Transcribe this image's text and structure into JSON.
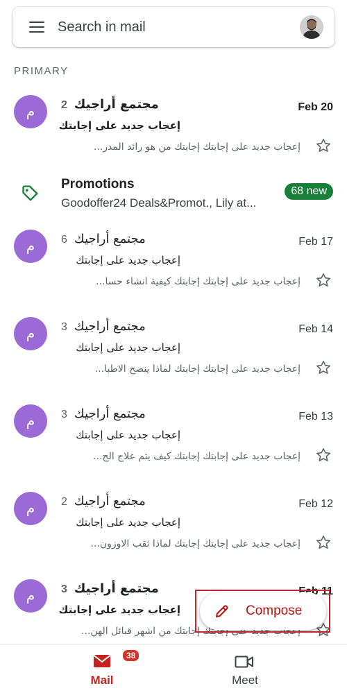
{
  "search": {
    "placeholder": "Search in mail"
  },
  "section": {
    "label": "PRIMARY"
  },
  "emails": [
    {
      "sender": "مجتمع أراجيك",
      "count": "2",
      "date": "Feb 20",
      "subject": "إعجاب جديد على إجابتك",
      "snippet": "إعجاب جديد على إجابتك إجابتك من هو رائد المدر...",
      "avatar_letter": "م",
      "unread": true
    },
    {
      "sender": "مجتمع أراجيك",
      "count": "6",
      "date": "Feb 17",
      "subject": "إعجاب جديد على إجابتك",
      "snippet": "إعجاب جديد على إجابتك إجابتك كيفية انشاء حسا...",
      "avatar_letter": "م",
      "unread": false
    },
    {
      "sender": "مجتمع أراجيك",
      "count": "3",
      "date": "Feb 14",
      "subject": "إعجاب جديد على إجابتك",
      "snippet": "إعجاب جديد على إجابتك إجابتك لماذا ينصح الاطبا...",
      "avatar_letter": "م",
      "unread": false
    },
    {
      "sender": "مجتمع أراجيك",
      "count": "3",
      "date": "Feb 13",
      "subject": "إعجاب جديد على إجابتك",
      "snippet": "إعجاب جديد على إجابتك إجابتك كيف يتم علاج الح...",
      "avatar_letter": "م",
      "unread": false
    },
    {
      "sender": "مجتمع أراجيك",
      "count": "2",
      "date": "Feb 12",
      "subject": "إعجاب جديد على إجابتك",
      "snippet": "إعجاب جديد على إجابتك إجابتك لماذا ثقب الاوزون...",
      "avatar_letter": "م",
      "unread": false
    },
    {
      "sender": "مجتمع أراجيك",
      "count": "3",
      "date": "Feb 11",
      "subject": "إعجاب جديد على إجابتك",
      "snippet": "إعجاب جديد على إجابتك إجابتك من اشهر قبائل الهن...",
      "avatar_letter": "م",
      "unread": true
    }
  ],
  "promotions": {
    "title": "Promotions",
    "senders": "Goodoffer24 Deals&Promot., Lily at...",
    "badge": "68 new"
  },
  "compose": {
    "label": "Compose"
  },
  "nav": {
    "mail_label": "Mail",
    "mail_badge": "38",
    "meet_label": "Meet"
  },
  "colors": {
    "accent": "#b31412",
    "avatar": "#9c6ad6",
    "promo_badge": "#188038",
    "badge_red": "#d93025"
  }
}
